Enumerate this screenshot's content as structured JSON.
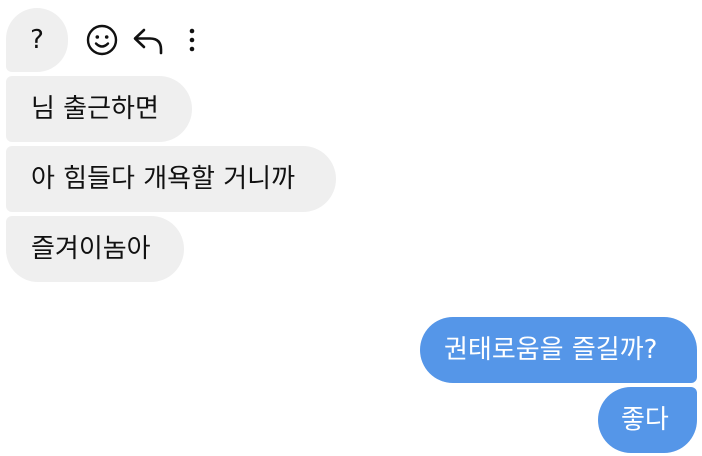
{
  "incoming": [
    {
      "text": "?"
    },
    {
      "text": "님 출근하면"
    },
    {
      "text": "아 힘들다 개욕할 거니까"
    },
    {
      "text": "즐겨이놈아"
    }
  ],
  "outgoing": [
    {
      "text": "권태로움을 즐길까?"
    },
    {
      "text": "좋다"
    }
  ],
  "actions": {
    "react_icon": "smile-icon",
    "reply_icon": "reply-icon",
    "more_icon": "more-vertical-icon"
  },
  "colors": {
    "incoming_bubble": "#efefef",
    "outgoing_bubble": "#5596e8",
    "incoming_text": "#111111",
    "outgoing_text": "#ffffff",
    "icon": "#111111"
  }
}
